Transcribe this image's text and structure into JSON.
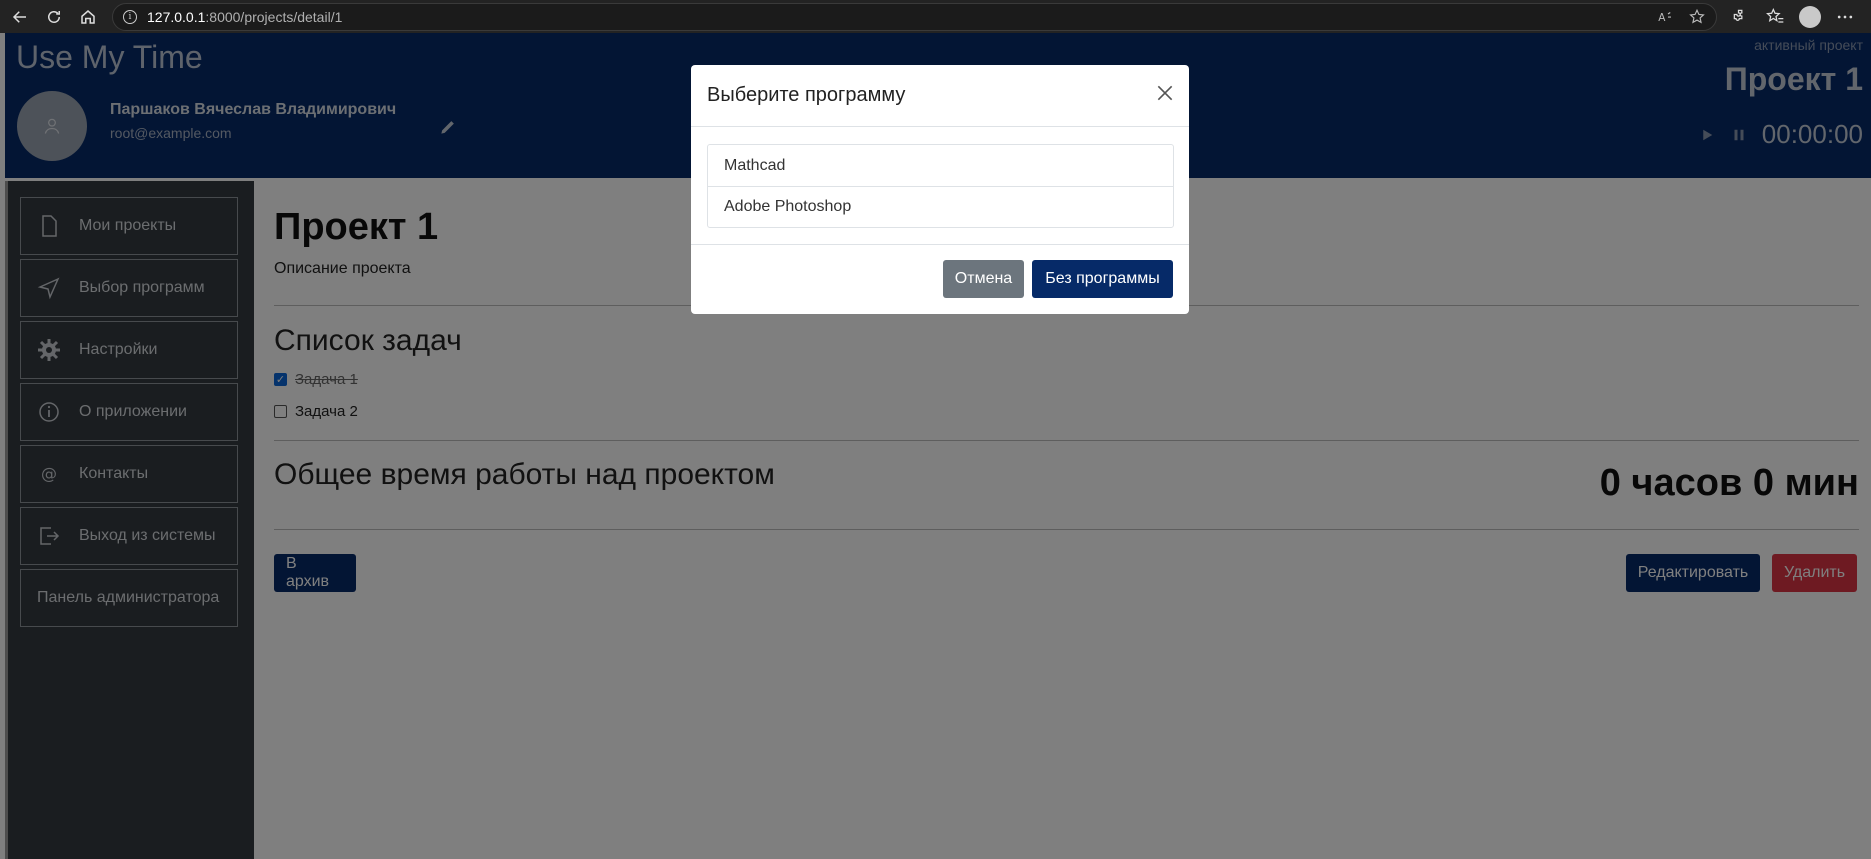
{
  "browser": {
    "url_host": "127.0.0.1",
    "url_rest": ":8000/projects/detail/1"
  },
  "header": {
    "app_title": "Use My Time",
    "user_name": "Паршаков Вячеслав Владимирович",
    "user_email": "root@example.com",
    "active_label": "активный проект",
    "active_project": "Проект 1",
    "timer": "00:00:00"
  },
  "sidebar": {
    "items": [
      {
        "label": "Мои проекты",
        "icon": "file-icon"
      },
      {
        "label": "Выбор программ",
        "icon": "send-icon"
      },
      {
        "label": "Настройки",
        "icon": "gear-icon"
      },
      {
        "label": "О приложении",
        "icon": "info-icon"
      },
      {
        "label": "Контакты",
        "icon": "at-icon"
      },
      {
        "label": "Выход из системы",
        "icon": "logout-icon"
      },
      {
        "label": "Панель администратора",
        "icon": ""
      }
    ]
  },
  "project": {
    "title": "Проект 1",
    "description": "Описание проекта",
    "tasks_title": "Список задач",
    "tasks": [
      {
        "label": "Задача 1",
        "checked": true
      },
      {
        "label": "Задача 2",
        "checked": false
      }
    ],
    "total_title": "Общее время работы над проектом",
    "total_value": "0 часов 0 мин",
    "archive_button": "В архив",
    "edit_button": "Редактировать",
    "delete_button": "Удалить"
  },
  "modal": {
    "title": "Выберите программу",
    "programs": [
      "Mathcad",
      "Adobe Photoshop"
    ],
    "cancel_button": "Отмена",
    "no_program_button": "Без программы"
  },
  "colors": {
    "brand": "#062a68",
    "danger": "#dc3545",
    "secondary": "#6c757d",
    "sidebar": "#343a40"
  }
}
